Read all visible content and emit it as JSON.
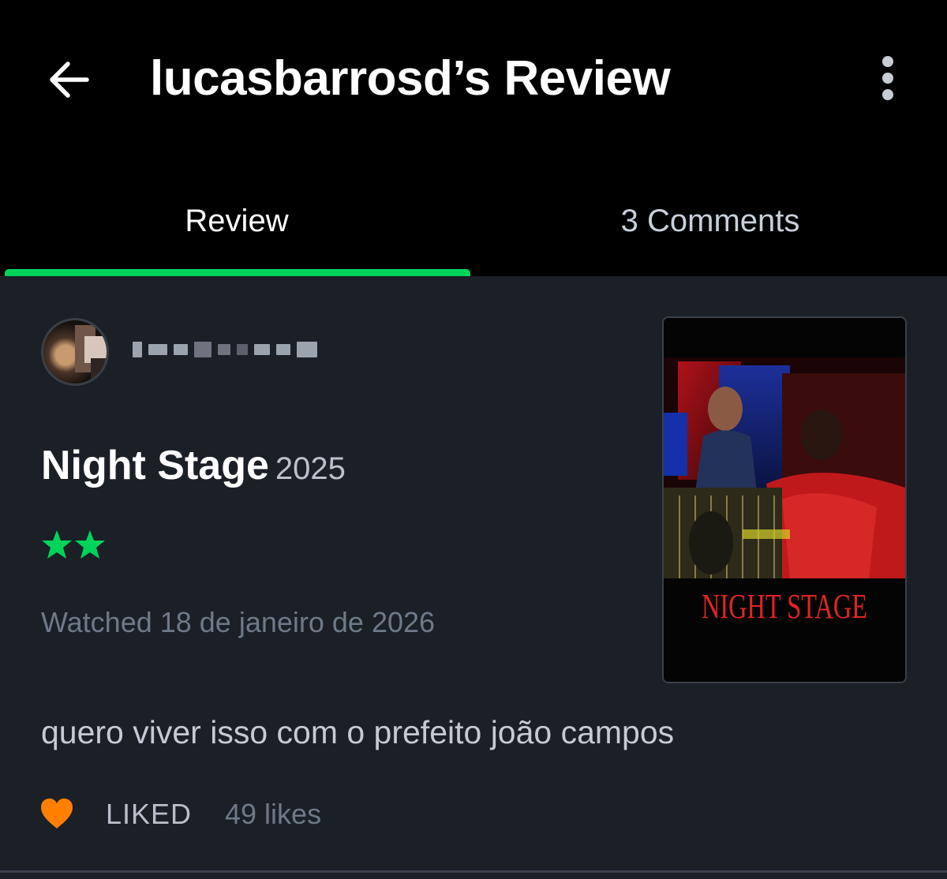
{
  "header": {
    "title": "lucasbarrosd’s Review",
    "back_icon": "arrow-left-icon",
    "more_icon": "more-vertical-icon"
  },
  "tabs": [
    {
      "label": "Review",
      "active": true
    },
    {
      "label": "3 Comments",
      "active": false
    }
  ],
  "review": {
    "username": "",
    "film_title": "Night Stage",
    "film_year": "2025",
    "rating_stars": 2,
    "watched_text": "Watched 18 de janeiro de 2026",
    "body": "quero viver isso com o prefeito joão campos",
    "liked_label": "LIKED",
    "likes_text": "49 likes"
  },
  "poster": {
    "title": "NIGHT STAGE"
  },
  "colors": {
    "accent_green": "#00d35a",
    "heart_orange": "#ff8000",
    "background": "#1b1f26",
    "header_background": "#000000"
  }
}
